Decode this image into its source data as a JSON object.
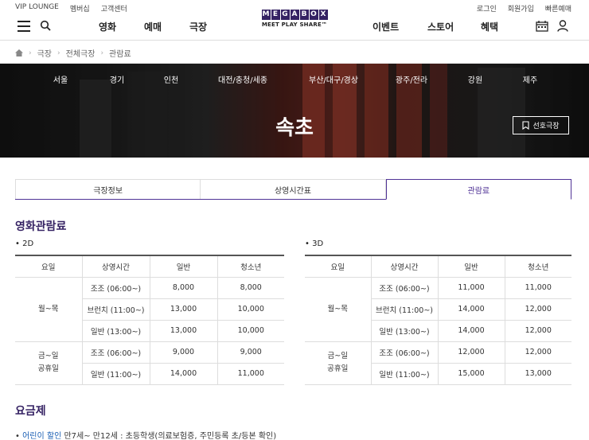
{
  "util": {
    "left": [
      "VIP LOUNGE",
      "멤버십",
      "고객센터"
    ],
    "right": [
      "로그인",
      "회원가입",
      "빠른예매"
    ]
  },
  "nav": {
    "left_menu": [
      "영화",
      "예매",
      "극장"
    ],
    "right_menu": [
      "이벤트",
      "스토어",
      "혜택"
    ],
    "logo_letters": [
      "M",
      "E",
      "G",
      "A",
      "B",
      "O",
      "X"
    ],
    "logo_sub": "MEET PLAY SHARE™"
  },
  "breadcrumb": [
    "극장",
    "전체극장",
    "관람료"
  ],
  "banner": {
    "regions": [
      "서울",
      "경기",
      "인천",
      "대전/충청/세종",
      "부산/대구/경상",
      "광주/전라",
      "강원",
      "제주"
    ],
    "theater": "속초",
    "fav_label": "선호극장"
  },
  "tabs": [
    "극장정보",
    "상영시간표",
    "관람료"
  ],
  "fees": {
    "title": "영화관람료",
    "headers": [
      "요일",
      "상영시간",
      "일반",
      "청소년"
    ],
    "table_2d": {
      "label": "• 2D",
      "group1": {
        "day": "월~목",
        "rows": [
          [
            "조조 (06:00~)",
            "8,000",
            "8,000"
          ],
          [
            "브런치 (11:00~)",
            "13,000",
            "10,000"
          ],
          [
            "일반 (13:00~)",
            "13,000",
            "10,000"
          ]
        ]
      },
      "group2": {
        "day_line1": "금~일",
        "day_line2": "공휴일",
        "rows": [
          [
            "조조 (06:00~)",
            "9,000",
            "9,000"
          ],
          [
            "일반 (11:00~)",
            "14,000",
            "11,000"
          ]
        ]
      }
    },
    "table_3d": {
      "label": "• 3D",
      "group1": {
        "day": "월~목",
        "rows": [
          [
            "조조 (06:00~)",
            "11,000",
            "11,000"
          ],
          [
            "브런치 (11:00~)",
            "14,000",
            "12,000"
          ],
          [
            "일반 (13:00~)",
            "14,000",
            "12,000"
          ]
        ]
      },
      "group2": {
        "day_line1": "금~일",
        "day_line2": "공휴일",
        "rows": [
          [
            "조조 (06:00~)",
            "12,000",
            "12,000"
          ],
          [
            "일반 (11:00~)",
            "15,000",
            "13,000"
          ]
        ]
      }
    }
  },
  "plans": {
    "title": "요금제",
    "bullet": "•",
    "item_highlight": "어린이 할인",
    "item_rest": " 만7세~ 만12세 : 초등학생(의료보험증, 주민등록 초/등본 확인)"
  },
  "colors": {
    "brand": "#352263",
    "accent": "#503396",
    "link": "#1a5fb4"
  }
}
